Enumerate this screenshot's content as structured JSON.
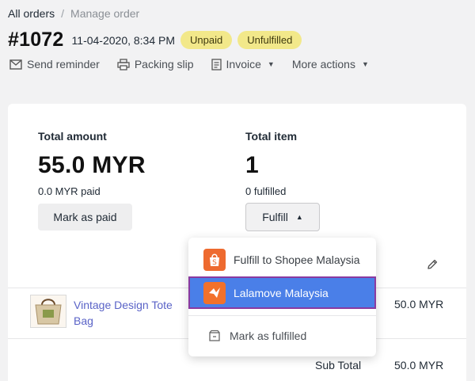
{
  "breadcrumb": {
    "all_orders": "All orders",
    "separator": "/",
    "current": "Manage order"
  },
  "order": {
    "number": "#1072",
    "date": "11-04-2020, 8:34 PM",
    "badges": [
      "Unpaid",
      "Unfulfilled"
    ]
  },
  "actions": {
    "send_reminder": "Send reminder",
    "packing_slip": "Packing slip",
    "invoice": "Invoice",
    "more_actions": "More actions"
  },
  "summary": {
    "total_amount_label": "Total amount",
    "total_amount_value": "55.0 MYR",
    "paid_text": "0.0 MYR paid",
    "mark_paid_label": "Mark as paid",
    "total_item_label": "Total item",
    "total_item_value": "1",
    "fulfilled_text": "0 fulfilled",
    "fulfill_label": "Fulfill"
  },
  "dropdown": {
    "items": [
      {
        "label": "Fulfill to Shopee Malaysia",
        "icon": "shopee-logo-icon"
      },
      {
        "label": "Lalamove Malaysia",
        "icon": "lalamove-logo-icon"
      },
      {
        "label": "Mark as fulfilled",
        "icon": "package-icon"
      }
    ]
  },
  "product": {
    "name": "Vintage Design Tote Bag",
    "price": "50.0 MYR"
  },
  "totals": {
    "subtotal_label": "Sub Total",
    "subtotal_value": "50.0 MYR"
  },
  "colors": {
    "badge_bg": "#f2e88a",
    "link": "#5a63c7",
    "highlight": "#4a7fe8",
    "shopee": "#ee6a2f",
    "lalamove": "#f2712b"
  }
}
